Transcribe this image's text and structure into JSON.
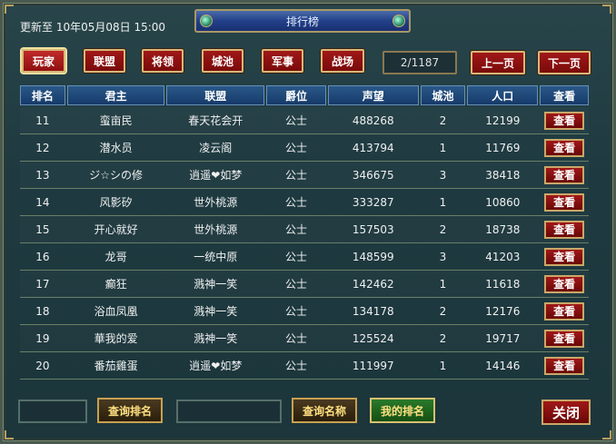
{
  "header": {
    "update_text": "更新至 10年05月08日 15:00",
    "title": "排行榜"
  },
  "tabs": [
    {
      "label": "玩家",
      "active": true
    },
    {
      "label": "联盟"
    },
    {
      "label": "将领"
    },
    {
      "label": "城池"
    },
    {
      "label": "军事"
    },
    {
      "label": "战场"
    }
  ],
  "pagination": {
    "page": "2/1187",
    "prev_label": "上一页",
    "next_label": "下一页"
  },
  "table": {
    "columns": [
      "排名",
      "君主",
      "联盟",
      "爵位",
      "声望",
      "城池",
      "人口",
      "查看"
    ],
    "view_label": "查看",
    "rows": [
      {
        "rank": "11",
        "lord": "蛮亩民",
        "alliance": "春天花会开",
        "title": "公士",
        "prestige": "488268",
        "cities": "2",
        "population": "12199"
      },
      {
        "rank": "12",
        "lord": "潜水员",
        "alliance": "凌云阁",
        "title": "公士",
        "prestige": "413794",
        "cities": "1",
        "population": "11769"
      },
      {
        "rank": "13",
        "lord": "ジ☆シの修",
        "alliance": "逍遥❤如梦",
        "title": "公士",
        "prestige": "346675",
        "cities": "3",
        "population": "38418"
      },
      {
        "rank": "14",
        "lord": "风影矽",
        "alliance": "世外桃源",
        "title": "公士",
        "prestige": "333287",
        "cities": "1",
        "population": "10860"
      },
      {
        "rank": "15",
        "lord": "开心就好",
        "alliance": "世外桃源",
        "title": "公士",
        "prestige": "157503",
        "cities": "2",
        "population": "18738"
      },
      {
        "rank": "16",
        "lord": "龙哥",
        "alliance": "一统中原",
        "title": "公士",
        "prestige": "148599",
        "cities": "3",
        "population": "41203"
      },
      {
        "rank": "17",
        "lord": "癫狂",
        "alliance": "溅神一笑",
        "title": "公士",
        "prestige": "142462",
        "cities": "1",
        "population": "11618"
      },
      {
        "rank": "18",
        "lord": "浴血凤凰",
        "alliance": "溅神一笑",
        "title": "公士",
        "prestige": "134178",
        "cities": "2",
        "population": "12176"
      },
      {
        "rank": "19",
        "lord": "華我的爱",
        "alliance": "溅神一笑",
        "title": "公士",
        "prestige": "125524",
        "cities": "2",
        "population": "19717"
      },
      {
        "rank": "20",
        "lord": "番茄雞蛋",
        "alliance": "逍遥❤如梦",
        "title": "公士",
        "prestige": "111997",
        "cities": "1",
        "population": "14146"
      }
    ]
  },
  "footer": {
    "rank_input_value": "",
    "query_rank_label": "查询排名",
    "name_input_value": "",
    "query_name_label": "查询名称",
    "my_rank_label": "我的排名",
    "close_label": "关闭"
  }
}
